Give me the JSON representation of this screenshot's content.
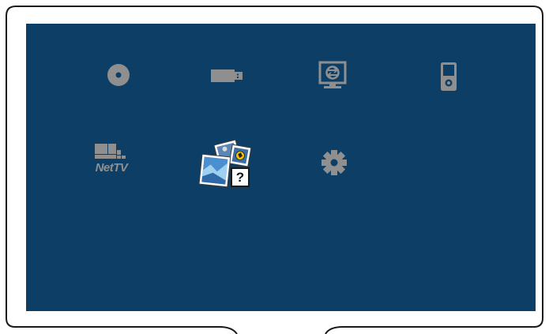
{
  "screen": {
    "background": "#0d3f66",
    "icon_color": "#8f8f8f",
    "menu_items": [
      {
        "id": "disc",
        "icon": "disc-icon",
        "selected": false
      },
      {
        "id": "usb",
        "icon": "usb-icon",
        "selected": false
      },
      {
        "id": "network",
        "icon": "network-monitor-icon",
        "selected": false
      },
      {
        "id": "media-player",
        "icon": "media-player-icon",
        "selected": false
      },
      {
        "id": "net-tv",
        "icon": "net-tv-icon",
        "label": "NetTV",
        "selected": false
      },
      {
        "id": "photo-help",
        "icon": "photo-help-icon",
        "label": "?",
        "selected": true
      },
      {
        "id": "settings",
        "icon": "gear-icon",
        "selected": false
      }
    ]
  }
}
